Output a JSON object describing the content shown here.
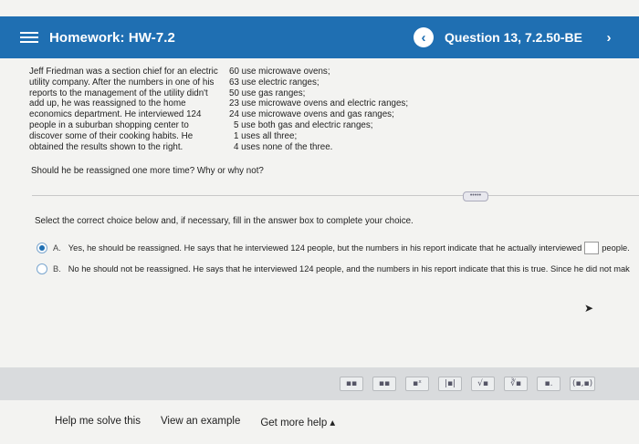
{
  "header": {
    "title": "Homework: HW-7.2",
    "question_label": "Question 13, 7.2.50-BE",
    "prev_glyph": "‹",
    "next_glyph": "›"
  },
  "problem": {
    "lines": [
      "Jeff Friedman was a section chief for an electric",
      "utility company. After the numbers in one of his",
      "reports to the management of the utility didn't",
      "add up, he was reassigned to the home",
      "economics department. He interviewed 124",
      "people in a suburban shopping center to",
      "discover some of their cooking habits. He",
      "obtained the results shown to the right."
    ],
    "survey": [
      "60 use microwave ovens;",
      "63 use electric ranges;",
      "50 use gas ranges;",
      "23 use microwave ovens and electric ranges;",
      "24 use microwave ovens and gas ranges;",
      "5 use both gas and electric ranges;",
      "1 uses all three;",
      "4 uses none of the three."
    ],
    "question": "Should he be reassigned one more time? Why or why not?"
  },
  "instruction": "Select the correct choice below and, if necessary, fill in the answer box to complete your choice.",
  "choices": [
    {
      "letter": "A.",
      "text": "Yes, he should be reassigned. He says that he interviewed 124 people, but the numbers in his report indicate that he actually interviewed",
      "suffix": "people."
    },
    {
      "letter": "B.",
      "text": "No he should not be reassigned. He says that he interviewed 124 people, and the numbers in his report indicate that this is true. Since he did not mak"
    }
  ],
  "more_button": "•••••",
  "tools": [
    "▪▪",
    "▪▪",
    "▪ˣ",
    "|▪|",
    "√▪",
    "∛▪",
    "▪.",
    "(▪,▪)"
  ],
  "footer": {
    "help": "Help me solve this",
    "example": "View an example",
    "more_help": "Get more help ▴"
  }
}
